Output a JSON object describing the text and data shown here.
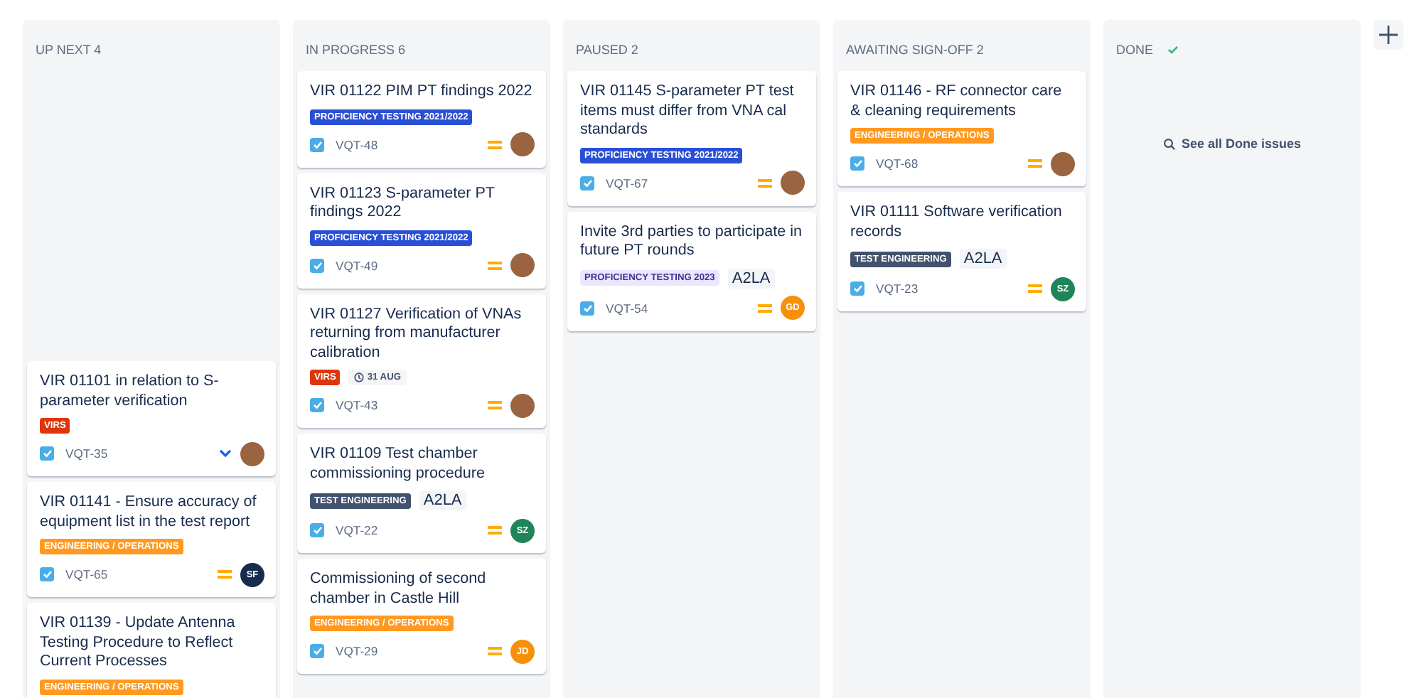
{
  "columns": [
    {
      "title": "UP NEXT 4",
      "kind": "list",
      "cards": [
        {
          "title": "VIR 01101 in relation to S-parameter verification",
          "labels": [
            {
              "text": "VIRS",
              "kind": "epic",
              "color": "#de350b"
            }
          ],
          "key": "VQT-35",
          "checked": true,
          "priority": {
            "kind": "low"
          },
          "assignee": {
            "kind": "photo"
          }
        },
        {
          "title": "VIR 01141 - Ensure accuracy of equipment list in the test report",
          "labels": [
            {
              "text": "ENGINEERING / OPERATIONS",
              "kind": "epic",
              "color": "#ff991f"
            }
          ],
          "key": "VQT-65",
          "checked": true,
          "priority": {
            "kind": "medium"
          },
          "assignee": {
            "kind": "initials",
            "initials": "SF",
            "color": "#172b4d"
          }
        },
        {
          "title": "VIR 01139 - Update Antenna Testing Procedure to Reflect Current Processes",
          "labels": [
            {
              "text": "ENGINEERING / OPERATIONS",
              "kind": "epic",
              "color": "#ff991f"
            }
          ]
        }
      ]
    },
    {
      "title": "IN PROGRESS 6",
      "kind": "list",
      "cards": [
        {
          "title": "VIR 01122 PIM PT findings 2022",
          "labels": [
            {
              "text": "PROFICIENCY TESTING 2021/2022",
              "kind": "epic",
              "color": "#2a4fd6"
            }
          ],
          "key": "VQT-48",
          "checked": true,
          "priority": {
            "kind": "medium"
          },
          "assignee": {
            "kind": "photo"
          }
        },
        {
          "title": "VIR 01123 S-parameter PT findings 2022",
          "labels": [
            {
              "text": "PROFICIENCY TESTING 2021/2022",
              "kind": "epic",
              "color": "#2a4fd6"
            }
          ],
          "key": "VQT-49",
          "checked": true,
          "priority": {
            "kind": "medium"
          },
          "assignee": {
            "kind": "photo"
          }
        },
        {
          "title": "VIR 01127 Verification of VNAs returning from manufacturer calibration",
          "labels": [
            {
              "text": "VIRS",
              "kind": "epic",
              "color": "#de350b"
            },
            {
              "text": "31 AUG",
              "kind": "due"
            }
          ],
          "key": "VQT-43",
          "checked": true,
          "priority": {
            "kind": "medium"
          },
          "assignee": {
            "kind": "photo"
          }
        },
        {
          "title": "VIR 01109 Test chamber commissioning procedure",
          "labels": [
            {
              "text": "TEST ENGINEERING",
              "kind": "epic",
              "color": "#42526e"
            },
            {
              "text": "A2LA",
              "kind": "plain"
            }
          ],
          "key": "VQT-22",
          "checked": true,
          "priority": {
            "kind": "medium"
          },
          "assignee": {
            "kind": "initials",
            "initials": "SZ",
            "color": "#1f845a"
          }
        },
        {
          "title": "Commissioning of second chamber in Castle Hill",
          "labels": [
            {
              "text": "ENGINEERING / OPERATIONS",
              "kind": "epic",
              "color": "#ff991f"
            }
          ],
          "key": "VQT-29",
          "checked": true,
          "priority": {
            "kind": "medium"
          },
          "assignee": {
            "kind": "initials",
            "initials": "JD",
            "color": "#f79009"
          }
        }
      ]
    },
    {
      "title": "PAUSED 2",
      "kind": "list",
      "cards": [
        {
          "title": "VIR 01145 S-parameter PT test items must differ from VNA cal standards",
          "labels": [
            {
              "text": "PROFICIENCY TESTING 2021/2022",
              "kind": "epic",
              "color": "#2a4fd6"
            }
          ],
          "key": "VQT-67",
          "checked": true,
          "priority": {
            "kind": "medium"
          },
          "assignee": {
            "kind": "photo"
          }
        },
        {
          "title": "Invite 3rd parties to participate in future PT rounds",
          "labels": [
            {
              "text": "PROFICIENCY TESTING 2023",
              "kind": "epic-light",
              "color": "#eae6ff"
            },
            {
              "text": "A2LA",
              "kind": "plain"
            }
          ],
          "key": "VQT-54",
          "checked": true,
          "priority": {
            "kind": "medium"
          },
          "assignee": {
            "kind": "initials",
            "initials": "GD",
            "color": "#f79009"
          }
        }
      ]
    },
    {
      "title": "AWAITING SIGN-OFF 2",
      "kind": "list",
      "cards": [
        {
          "title": "VIR 01146 - RF connector care & cleaning requirements",
          "labels": [
            {
              "text": "ENGINEERING / OPERATIONS",
              "kind": "epic",
              "color": "#ff991f"
            }
          ],
          "key": "VQT-68",
          "checked": true,
          "priority": {
            "kind": "medium"
          },
          "assignee": {
            "kind": "photo"
          }
        },
        {
          "title": "VIR 01111 Software verification records",
          "labels": [
            {
              "text": "TEST ENGINEERING",
              "kind": "epic",
              "color": "#42526e"
            },
            {
              "text": "A2LA",
              "kind": "plain"
            }
          ],
          "key": "VQT-23",
          "checked": true,
          "priority": {
            "kind": "medium"
          },
          "assignee": {
            "kind": "initials",
            "initials": "SZ",
            "color": "#1f845a"
          }
        }
      ]
    },
    {
      "title": "DONE",
      "kind": "done",
      "link": "See all Done issues"
    }
  ]
}
